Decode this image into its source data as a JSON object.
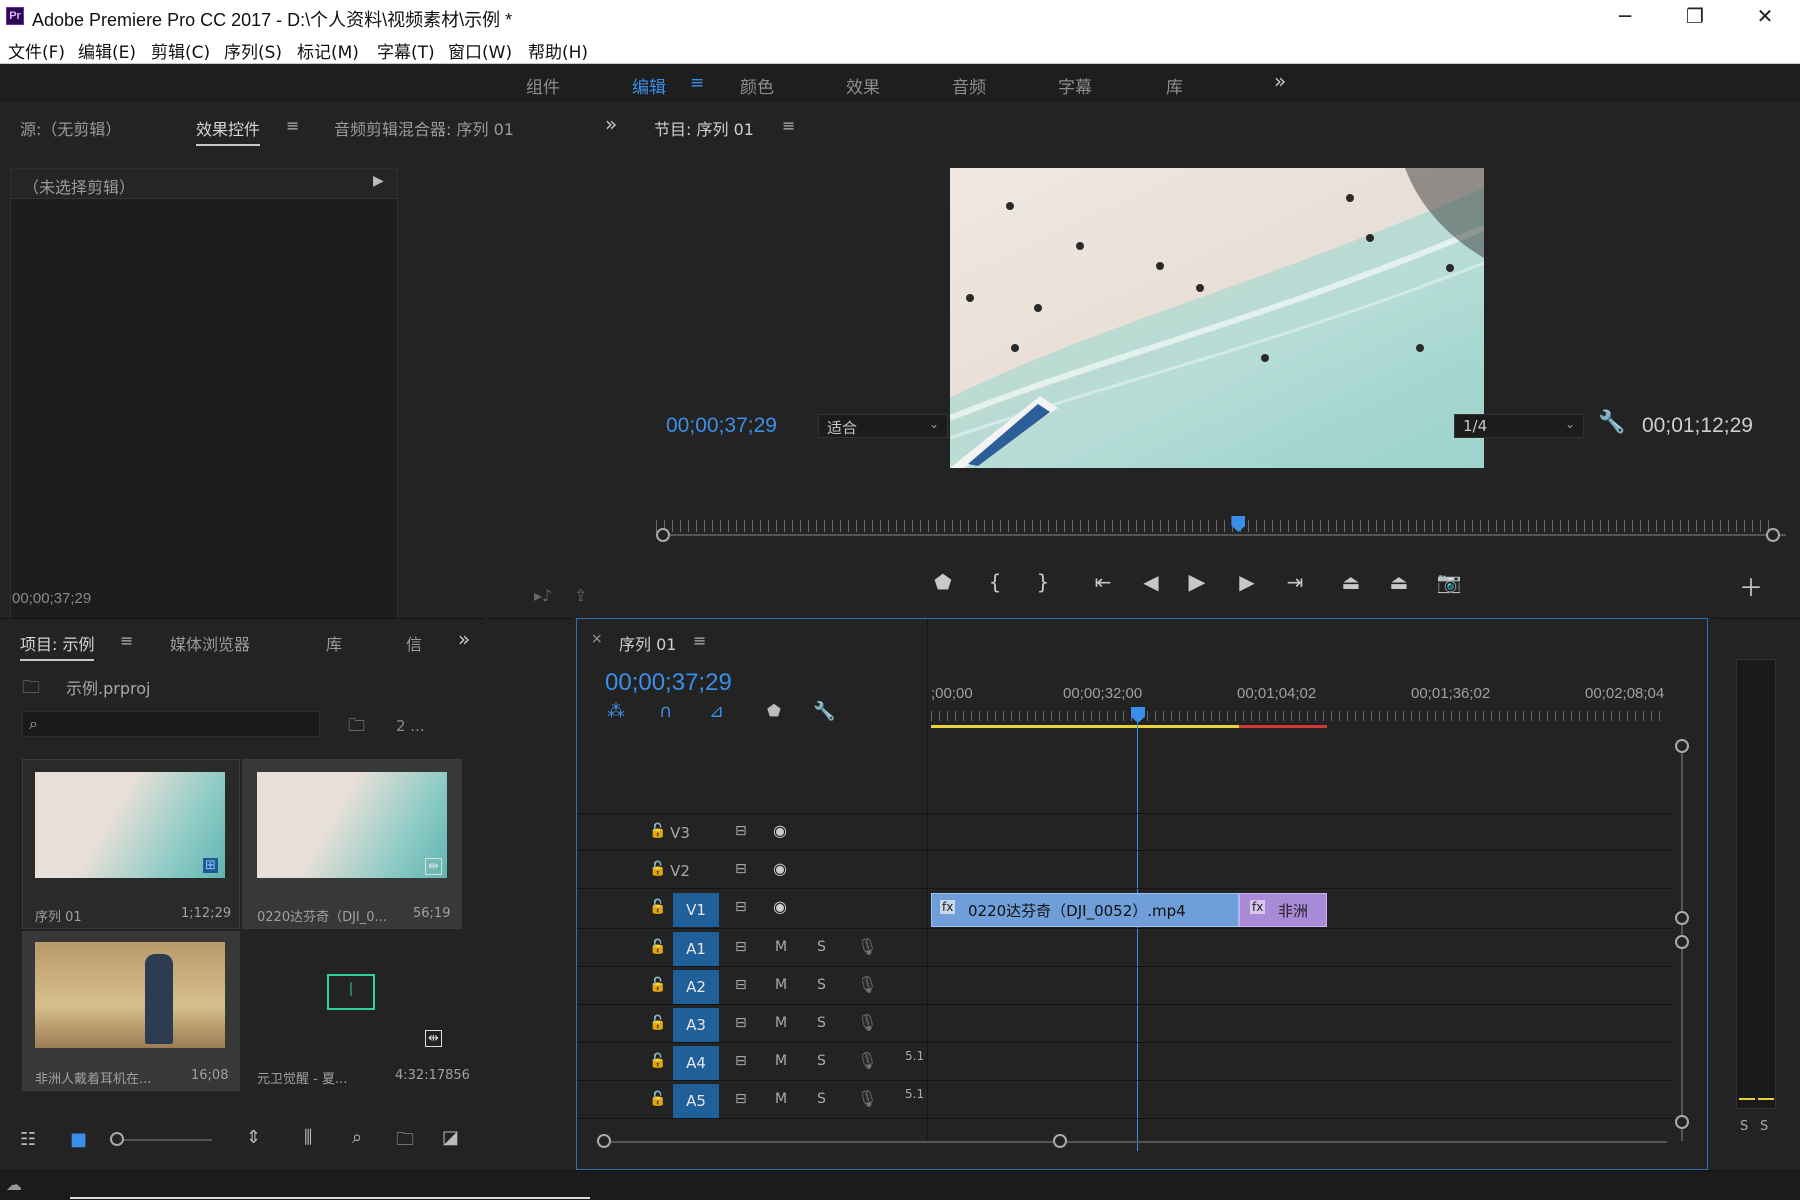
{
  "window": {
    "title": "Adobe Premiere Pro CC 2017 - D:\\个人资料\\视频素材\\示例 *",
    "app_icon": "Pr",
    "min": "─",
    "max": "❐",
    "close": "✕"
  },
  "menu": [
    "文件(F)",
    "编辑(E)",
    "剪辑(C)",
    "序列(S)",
    "标记(M)",
    "字幕(T)",
    "窗口(W)",
    "帮助(H)"
  ],
  "workspaces": {
    "items": [
      "组件",
      "编辑",
      "颜色",
      "效果",
      "音频",
      "字幕",
      "库"
    ],
    "active": "编辑",
    "more": "»"
  },
  "source_panel": {
    "tabs": [
      "源:（无剪辑）",
      "效果控件",
      "音频剪辑混合器: 序列 01"
    ],
    "active_tab": "效果控件",
    "more": "»",
    "no_clip": "（未选择剪辑）",
    "timecode": "00;00;37;29"
  },
  "program_monitor": {
    "tab": "节目: 序列 01",
    "timecode_current": "00;00;37;29",
    "fit": "适合",
    "resolution": "1/4",
    "timecode_total": "00;01;12;29",
    "playhead_fraction": 0.52
  },
  "project_panel": {
    "tabs": [
      "项目: 示例",
      "媒体浏览器",
      "库",
      "信"
    ],
    "active_tab": "项目: 示例",
    "more": "»",
    "file": "示例.prproj",
    "count": "2 ...",
    "items": [
      {
        "name": "序列 01",
        "duration": "1;12;29"
      },
      {
        "name": "0220达芬奇（DJI_0...",
        "duration": "56;19"
      },
      {
        "name": "非洲人戴着耳机在...",
        "duration": "16;08"
      },
      {
        "name": "元卫觉醒 - 夏...",
        "duration": "4:32:17856"
      }
    ]
  },
  "timeline": {
    "tab": "序列 01",
    "close": "×",
    "timecode": "00;00;37;29",
    "ruler_labels": [
      ";00;00",
      "00;00;32;00",
      "00;01;04;02",
      "00;01;36;02",
      "00;02;08;04"
    ],
    "video_tracks": [
      "V3",
      "V2",
      "V1"
    ],
    "audio_tracks": [
      "A1",
      "A2",
      "A3",
      "A4",
      "A5"
    ],
    "mute": "M",
    "solo": "S",
    "channel_label": "5.1",
    "clips": [
      {
        "label": "0220达芬奇（DJI_0052）.mp4",
        "fx": "fx"
      },
      {
        "label": "非洲",
        "fx": "fx"
      }
    ]
  },
  "meters": {
    "s1": "S",
    "s2": "S"
  },
  "colors": {
    "accent": "#3b8ee8",
    "clip_video": "#6f9ed8",
    "clip_purple": "#a98ad6",
    "work_yellow": "#e6d23a",
    "work_red": "#d23a3a"
  }
}
